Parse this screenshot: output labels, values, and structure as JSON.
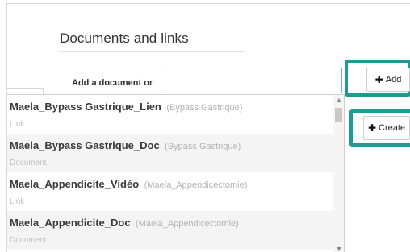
{
  "section": {
    "title": "Documents and links"
  },
  "form": {
    "label": "Add a document or",
    "input_value": "",
    "input_placeholder": ""
  },
  "buttons": {
    "add_icon": "plus-icon",
    "add_label": "Add",
    "create_icon": "plus-icon",
    "create_label": "Create"
  },
  "highlight_color": "#1f9a92",
  "dropdown": {
    "items": [
      {
        "name": "Maela_Bypass Gastrique_Lien",
        "context": "(Bypass Gastrique)",
        "type": "Link"
      },
      {
        "name": "Maela_Bypass Gastrique_Doc",
        "context": "(Bypass Gastrique)",
        "type": "Document"
      },
      {
        "name": "Maela_Appendicite_Vidéo",
        "context": "(Maela_Appendicectomie)",
        "type": "Link"
      },
      {
        "name": "Maela_Appendicite_Doc",
        "context": "(Maela_Appendicectomie)",
        "type": "Document"
      }
    ]
  }
}
